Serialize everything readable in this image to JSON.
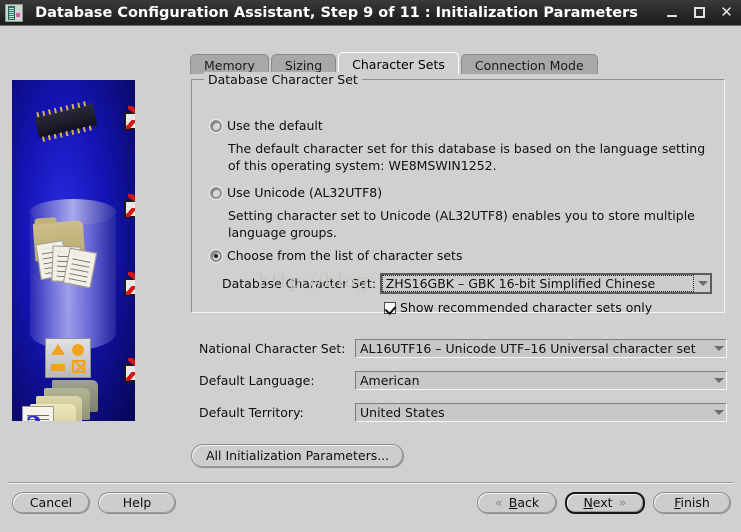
{
  "window": {
    "title": "Database Configuration Assistant, Step 9 of 11 : Initialization Parameters",
    "icon": "database-chip-icon",
    "minimize_label": "–",
    "maximize_label": "□",
    "close_label": "✕"
  },
  "tabs": [
    {
      "label": "Memory",
      "active": false
    },
    {
      "label": "Sizing",
      "active": false
    },
    {
      "label": "Character Sets",
      "active": true
    },
    {
      "label": "Connection Mode",
      "active": false
    }
  ],
  "group": {
    "title": "Database Character Set",
    "options": [
      {
        "label": "Use the default",
        "selected": false,
        "description": "The default character set for this database is based on the language setting of this operating system: WE8MSWIN1252."
      },
      {
        "label": "Use Unicode (AL32UTF8)",
        "selected": false,
        "description": "Setting character set to Unicode (AL32UTF8) enables you to store multiple language groups."
      },
      {
        "label": "Choose from the list of character sets",
        "selected": true,
        "description": ""
      }
    ],
    "db_charset_label": "Database Character Set:",
    "db_charset_value": "ZHS16GBK – GBK 16-bit Simplified Chinese",
    "recommended_checkbox_label": "Show recommended character sets only",
    "recommended_checked": true
  },
  "fields": [
    {
      "label": "National Character Set:",
      "value": "AL16UTF16 – Unicode UTF–16 Universal character set"
    },
    {
      "label": "Default Language:",
      "value": "American"
    },
    {
      "label": "Default Territory:",
      "value": "United States"
    }
  ],
  "all_init_button": "All Initialization Parameters...",
  "footer": {
    "cancel": "Cancel",
    "help": "Help",
    "back": "Back",
    "back_mnemonic": "B",
    "next": "Next",
    "next_mnemonic": "N",
    "finish": "Finish",
    "finish_mnemonic": "F",
    "back_icon": "«",
    "next_icon": "»"
  },
  "watermark": "http://blog.",
  "colors": {
    "window_bg": "#d0d0d0",
    "titlebar": "#262626",
    "banner_blue": "#1414b4",
    "accent_red": "#d41616",
    "tab_inactive": "#a8a8a8"
  }
}
